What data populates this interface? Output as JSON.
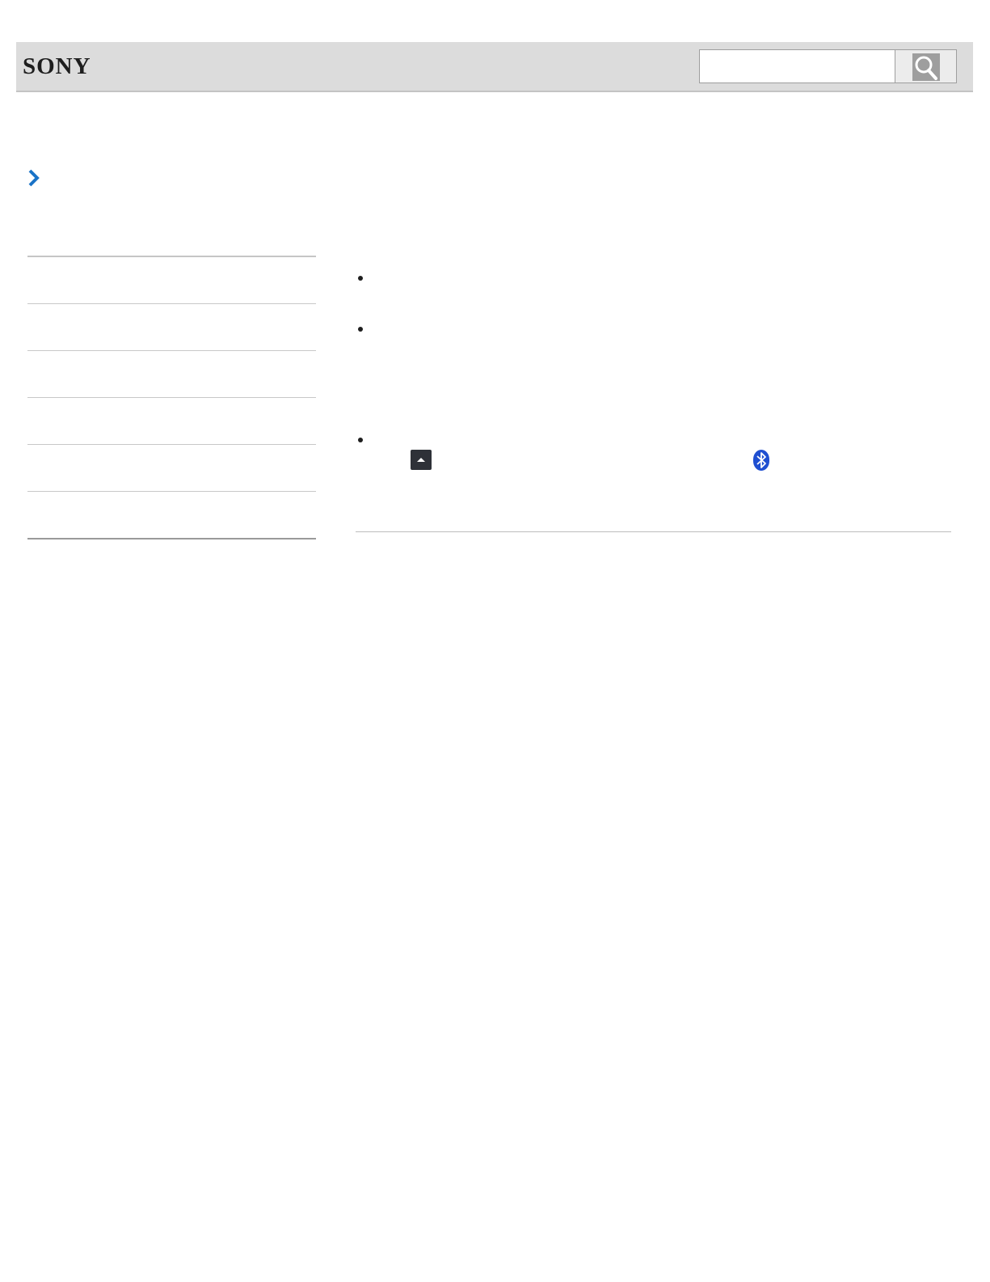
{
  "brand": {
    "logo": "SONY"
  },
  "search": {
    "placeholder": "",
    "value": ""
  },
  "colors": {
    "header_bg": "#dcdcdc",
    "chevron": "#1a73c7",
    "bluetooth": "#1f4fd1"
  },
  "icons": {
    "search_button": "magnifier-icon",
    "nav_toggle": "chevron-right-icon",
    "button_glyph": "up-arrow-icon",
    "status_glyph": "bluetooth-icon"
  },
  "sidebar": {
    "items": [
      "",
      "",
      "",
      "",
      "",
      ""
    ]
  },
  "content": {
    "bullets": [
      "",
      "",
      ""
    ]
  }
}
